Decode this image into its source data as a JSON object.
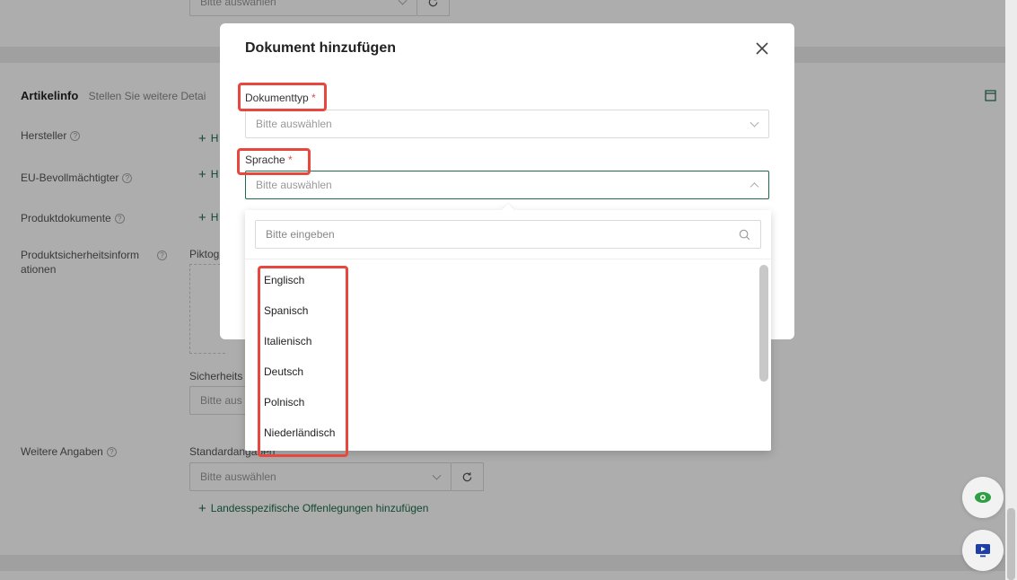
{
  "background": {
    "top_select_placeholder": "Bitte auswählen",
    "section": {
      "title": "Artikelinfo",
      "subtitle": "Stellen Sie weitere Detai"
    },
    "fields": {
      "hersteller": "Hersteller",
      "eu_bevollmaechtigter": "EU-Bevollmächtigter",
      "produktdokumente": "Produktdokumente",
      "produktsicherheit": "Produktsicherheitsinform ationen",
      "weitere_angaben": "Weitere Angaben"
    },
    "add_link_prefix": "H",
    "piktog_label": "Piktog",
    "sicherheit_label": "Sicherheits",
    "sicherheit_select": "Bitte aus",
    "standard_label": "Standardangaben",
    "standard_select_placeholder": "Bitte auswählen",
    "landes_link": "Landesspezifische Offenlegungen hinzufügen"
  },
  "modal": {
    "title": "Dokument hinzufügen",
    "doc_type_label": "Dokumenttyp",
    "doc_type_placeholder": "Bitte auswählen",
    "language_label": "Sprache",
    "language_placeholder": "Bitte auswählen",
    "required_mark": "*"
  },
  "dropdown": {
    "search_placeholder": "Bitte eingeben",
    "options": [
      "Englisch",
      "Spanisch",
      "Italienisch",
      "Deutsch",
      "Polnisch",
      "Niederländisch"
    ]
  },
  "colors": {
    "accent": "#1f6b4a",
    "highlight": "#e8473d",
    "required": "#e5484d"
  }
}
